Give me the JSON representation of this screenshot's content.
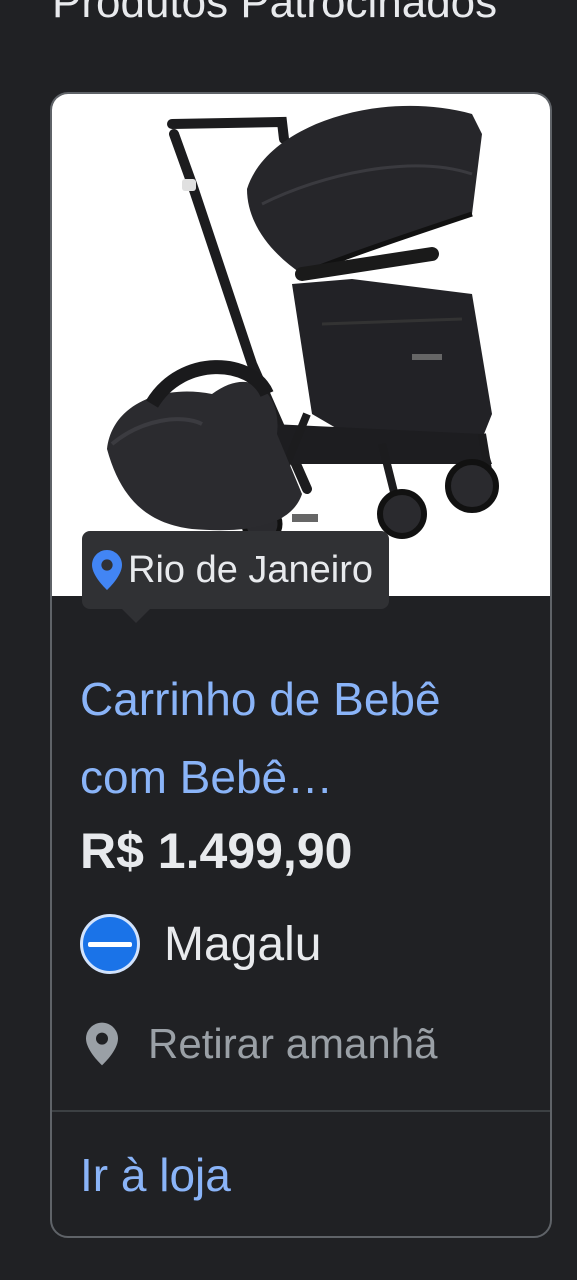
{
  "header": {
    "title": "Produtos Patrocinados"
  },
  "card": {
    "image_alt": "stroller-with-baby-car-seat",
    "location": "Rio de Janeiro",
    "title": "Carrinho de Bebê com Bebê…",
    "price": "R$ 1.499,90",
    "store": {
      "name": "Magalu",
      "logo_color": "#1a73e8"
    },
    "pickup": "Retirar amanhã",
    "link_label": "Ir à loja"
  },
  "colors": {
    "background": "#202124",
    "link": "#8ab4f8",
    "text": "#e8eaed",
    "muted": "#9aa0a6",
    "pin_blue": "#4285f4"
  }
}
